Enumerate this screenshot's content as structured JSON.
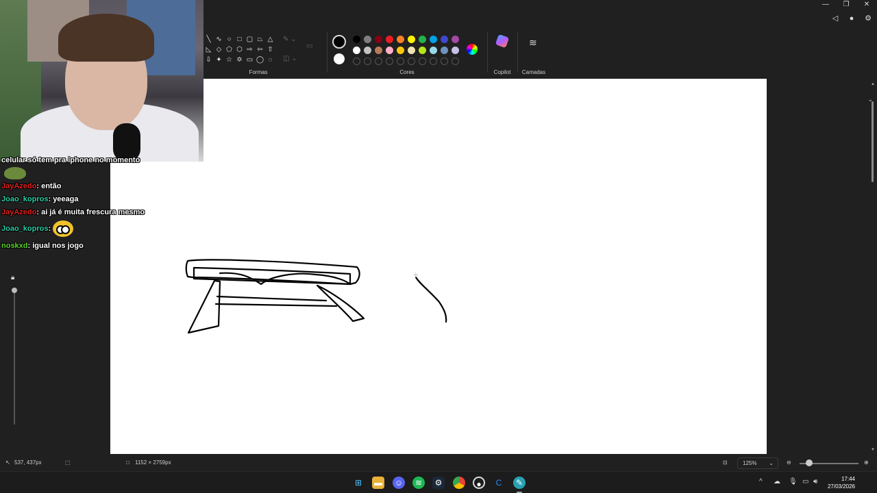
{
  "window": {
    "minimize_icon": "minimize-icon",
    "restore_icon": "restore-icon",
    "close_icon": "close-icon",
    "minimize": "—",
    "restore": "❐",
    "close": "✕"
  },
  "ribbon": {
    "shapes_label": "Formas",
    "colors_label": "Cores",
    "copilot_label": "Copilot",
    "layers_label": "Camadas",
    "primary_color": "#000000",
    "secondary_color": "#ffffff",
    "swatches_row1": [
      "#000000",
      "#7f7f7f",
      "#880015",
      "#ed1c24",
      "#ff7f27",
      "#fff200",
      "#22b14c",
      "#00a2e8",
      "#3f48cc",
      "#a349a4"
    ],
    "swatches_row2": [
      "#ffffff",
      "#c3c3c3",
      "#b97a57",
      "#ffaec9",
      "#ffc90e",
      "#efe4b0",
      "#b5e61d",
      "#99d9ea",
      "#7092be",
      "#c8bfe7"
    ],
    "swatches_row3_empty": 10
  },
  "chat": [
    {
      "user": "celular só tem pra iphone no momento",
      "message": "",
      "user_color": "#ffffff"
    },
    {
      "user": "JayAzedo",
      "message": ": então",
      "user_color": "#e02020"
    },
    {
      "user": "Joao_kopros",
      "message": ": yeeaga",
      "user_color": "#2ecfa8"
    },
    {
      "user": "JayAzedo",
      "message": ": ai já é muita frescura mesmo",
      "user_color": "#e02020"
    },
    {
      "user": "Joao_kopros",
      "message": ":",
      "user_color": "#2ecfa8"
    },
    {
      "user": "noskxd",
      "message": ": igual nos jogo",
      "user_color": "#5bd22b"
    }
  ],
  "status": {
    "cursor_pos": "537, 437px",
    "canvas_size": "1152 × 2759px",
    "zoom": "125%"
  },
  "clock": {
    "time": "17:44",
    "date": "27/03/2026"
  }
}
